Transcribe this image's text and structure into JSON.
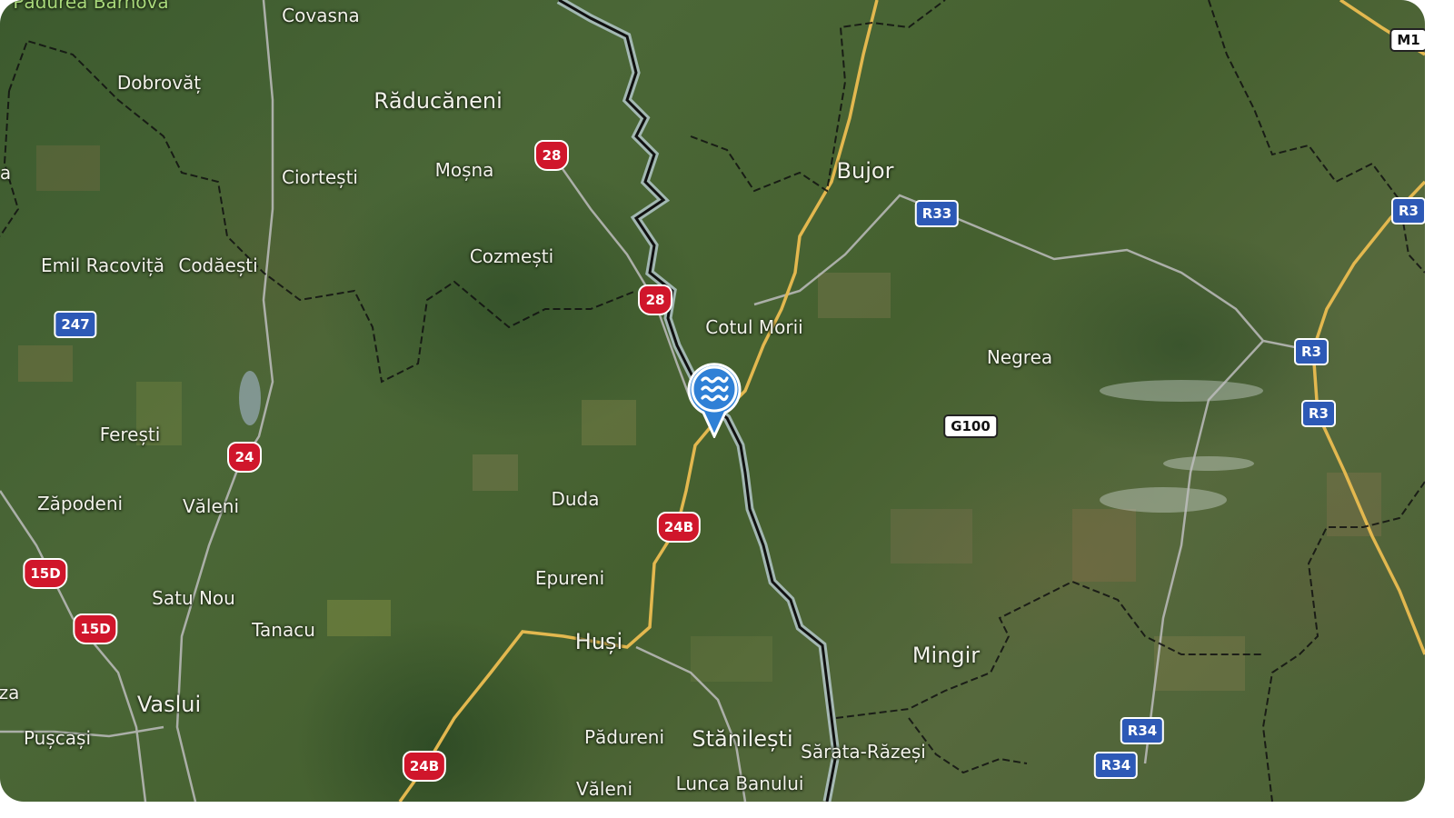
{
  "map": {
    "type": "satellite",
    "marker": {
      "icon": "water-waves-icon",
      "color": "#2f80d6"
    },
    "colors": {
      "border": "#111111",
      "border_halo": "#bfd2e0",
      "road_major": "#e3b84f",
      "road_minor": "#b8b8b8"
    }
  },
  "places": [
    {
      "name": "Pădurea Bârnova",
      "key": "padurea-barnova"
    },
    {
      "name": "Covasna",
      "key": "covasna"
    },
    {
      "name": "Dobrovăț",
      "key": "dobrovat"
    },
    {
      "name": "Răducăneni",
      "key": "raducaneni"
    },
    {
      "name": "Ciortești",
      "key": "ciortesti"
    },
    {
      "name": "Moșna",
      "key": "mosna"
    },
    {
      "name": "Bujor",
      "key": "bujor"
    },
    {
      "name": "Cozmești",
      "key": "cozmesti"
    },
    {
      "name": "Emil Racoviță",
      "key": "emil-racovita"
    },
    {
      "name": "Codăești",
      "key": "codaesti"
    },
    {
      "name": "Cotul Morii",
      "key": "cotul-morii"
    },
    {
      "name": "Negrea",
      "key": "negrea"
    },
    {
      "name": "Ferești",
      "key": "feresti"
    },
    {
      "name": "Zăpodeni",
      "key": "zapodeni"
    },
    {
      "name": "Văleni",
      "key": "valeni"
    },
    {
      "name": "Duda",
      "key": "duda"
    },
    {
      "name": "Epureni",
      "key": "epureni"
    },
    {
      "name": "Satu Nou",
      "key": "satu-nou"
    },
    {
      "name": "Tanacu",
      "key": "tanacu"
    },
    {
      "name": "Huși",
      "key": "husi"
    },
    {
      "name": "Mingir",
      "key": "mingir"
    },
    {
      "name": "Vaslui",
      "key": "vaslui"
    },
    {
      "name": "Pușcași",
      "key": "puscasi"
    },
    {
      "name": "Pădureni",
      "key": "padureni"
    },
    {
      "name": "Stănilești",
      "key": "stanilesti"
    },
    {
      "name": "Sărata-Răzeși",
      "key": "sarata-razesi"
    },
    {
      "name": "Văleni",
      "key": "valeni-2"
    },
    {
      "name": "Lunca Banului",
      "key": "lunca-banului"
    },
    {
      "name": "a",
      "key": "edge-left-a"
    },
    {
      "name": "za",
      "key": "edge-left-za"
    }
  ],
  "road_shields": [
    {
      "label": "M1",
      "type": "national"
    },
    {
      "label": "28",
      "type": "ro"
    },
    {
      "label": "R33",
      "type": "eu"
    },
    {
      "label": "R3",
      "type": "eu"
    },
    {
      "label": "247",
      "type": "eu"
    },
    {
      "label": "28",
      "type": "ro"
    },
    {
      "label": "R3",
      "type": "eu"
    },
    {
      "label": "R3",
      "type": "eu"
    },
    {
      "label": "G100",
      "type": "national"
    },
    {
      "label": "24",
      "type": "ro"
    },
    {
      "label": "24B",
      "type": "ro"
    },
    {
      "label": "15D",
      "type": "ro"
    },
    {
      "label": "15D",
      "type": "ro"
    },
    {
      "label": "R34",
      "type": "eu"
    },
    {
      "label": "R34",
      "type": "eu"
    },
    {
      "label": "24B",
      "type": "ro"
    }
  ]
}
